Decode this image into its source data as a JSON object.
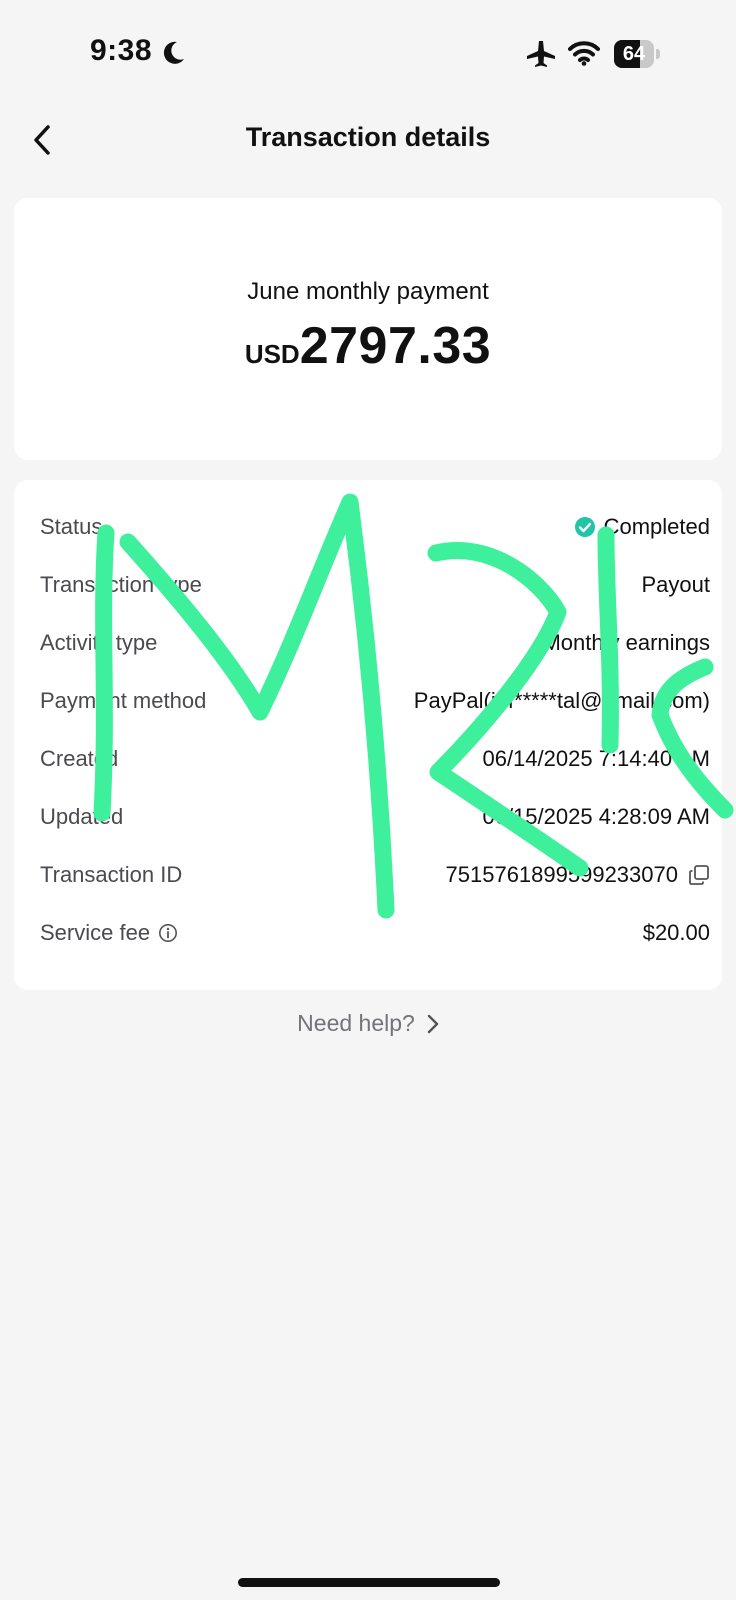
{
  "status_bar": {
    "time": "9:38",
    "battery": "64",
    "battery_level_percent": 64,
    "icons": [
      "moon-icon",
      "airplane-icon",
      "wifi-icon",
      "battery-icon"
    ]
  },
  "header": {
    "title": "Transaction details",
    "back_icon": "chevron-left-icon"
  },
  "summary": {
    "description": "June monthly payment",
    "currency": "USD",
    "amount": "2797.33"
  },
  "details": [
    {
      "label": "Status",
      "value": "Completed",
      "value_icon": "check-circle-icon",
      "value_icon_color": "#20c5a7"
    },
    {
      "label": "Transaction type",
      "value": "Payout"
    },
    {
      "label": "Activity type",
      "value": "Monthly earnings"
    },
    {
      "label": "Payment method",
      "value": "PayPal(inf*****tal@gmail.com)"
    },
    {
      "label": "Created",
      "value": "06/14/2025 7:14:40 AM"
    },
    {
      "label": "Updated",
      "value": "06/15/2025 4:28:09 AM"
    },
    {
      "label": "Transaction ID",
      "value": "7515761899599233070",
      "value_icon": "copy-icon"
    },
    {
      "label": "Service fee",
      "label_icon": "info-icon",
      "value": "$20.00"
    }
  ],
  "help": {
    "label": "Need help?",
    "icon": "chevron-right-icon"
  },
  "colors": {
    "background": "#f5f5f6",
    "card": "#ffffff",
    "success": "#20c5a7",
    "scribble": "#3ef09b"
  }
}
